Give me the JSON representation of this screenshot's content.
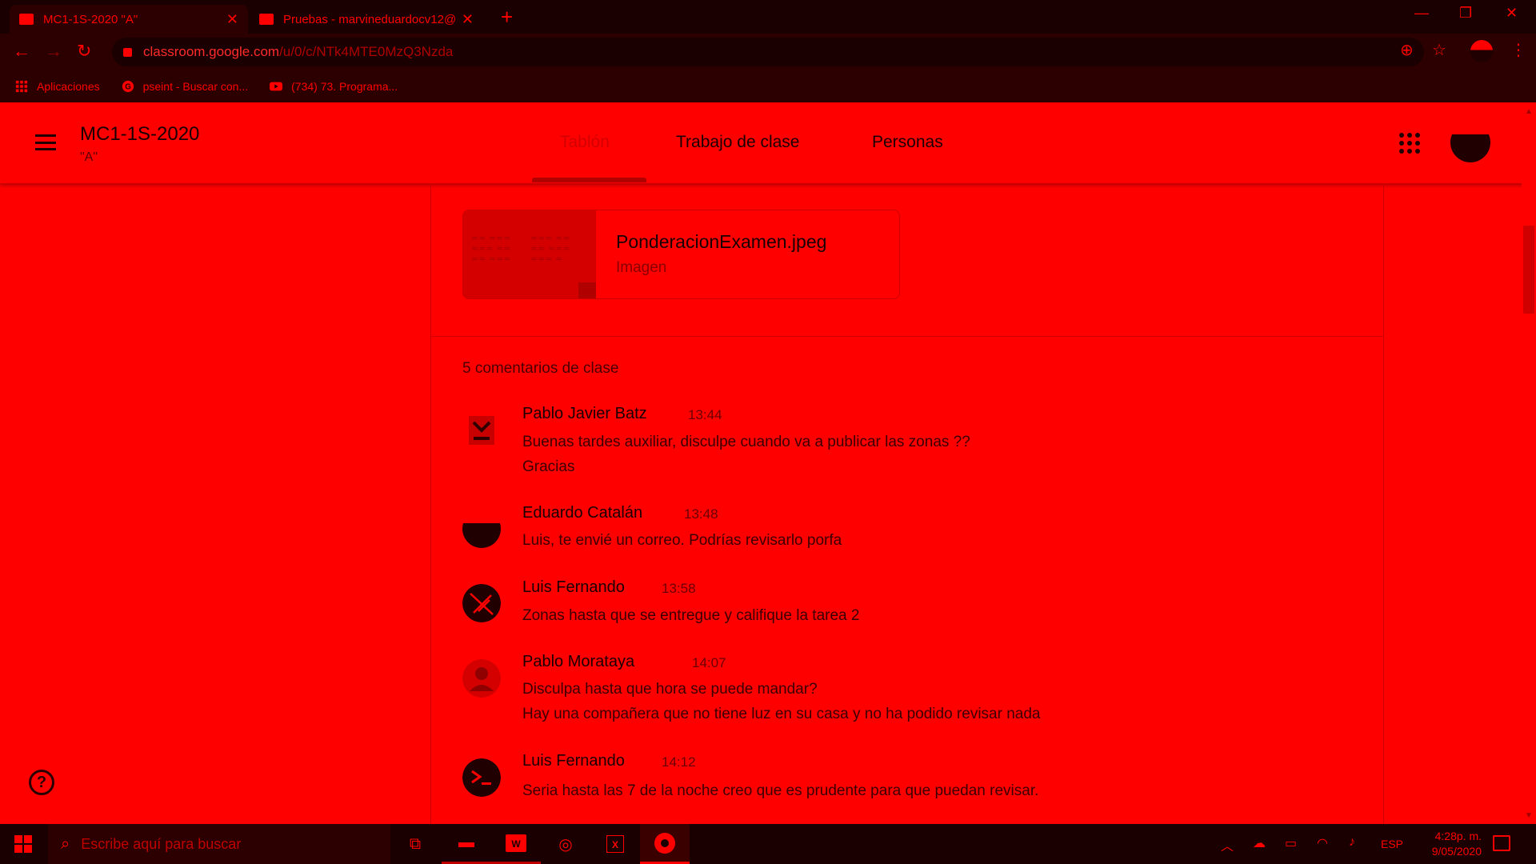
{
  "browser": {
    "tabs": [
      {
        "title": "MC1-1S-2020 \"A\"",
        "active": true
      },
      {
        "title": "Pruebas - marvineduardocv12@",
        "active": false
      }
    ],
    "url_host": "classroom.google.com",
    "url_path": "/u/0/c/NTk4MTE0MzQ3Nzda",
    "bookmarks": [
      {
        "label": "Aplicaciones",
        "icon": "apps-grid-icon"
      },
      {
        "label": "pseint - Buscar con...",
        "icon": "google-icon"
      },
      {
        "label": "(734) 73. Programa...",
        "icon": "youtube-icon"
      }
    ]
  },
  "classroom": {
    "course_title": "MC1-1S-2020",
    "course_section": "\"A\"",
    "nav_tabs": [
      "Tablón",
      "Trabajo de clase",
      "Personas"
    ],
    "active_tab": "Tablón"
  },
  "attachment": {
    "name": "PonderacionExamen.jpeg",
    "type": "Imagen"
  },
  "comments_count_label": "5 comentarios de clase",
  "comments": [
    {
      "author": "Pablo Javier Batz",
      "time": "13:44",
      "lines": [
        "Buenas tardes auxiliar, disculpe cuando va a publicar las zonas ??",
        "Gracias"
      ]
    },
    {
      "author": "Eduardo Catalán",
      "time": "13:48",
      "lines": [
        "Luis, te envié un correo. Podrías revisarlo porfa"
      ]
    },
    {
      "author": "Luis Fernando",
      "time": "13:58",
      "lines": [
        "Zonas hasta que se entregue y califique la tarea 2"
      ]
    },
    {
      "author": "Pablo Morataya",
      "time": "14:07",
      "lines": [
        "Disculpa hasta que hora se puede mandar?",
        "Hay una compañera que no tiene luz en su casa y no ha podido revisar nada"
      ]
    },
    {
      "author": "Luis Fernando",
      "time": "14:12",
      "lines": [
        "Seria hasta las 7 de la noche creo que es prudente para que puedan revisar."
      ]
    }
  ],
  "taskbar": {
    "search_placeholder": "Escribe aquí para buscar",
    "language": "ESP",
    "time": "4:28p. m.",
    "date": "9/05/2020"
  },
  "colors": {
    "background": "#ff0000",
    "chrome_dark": "#1a0000",
    "text": "#1a0000"
  }
}
